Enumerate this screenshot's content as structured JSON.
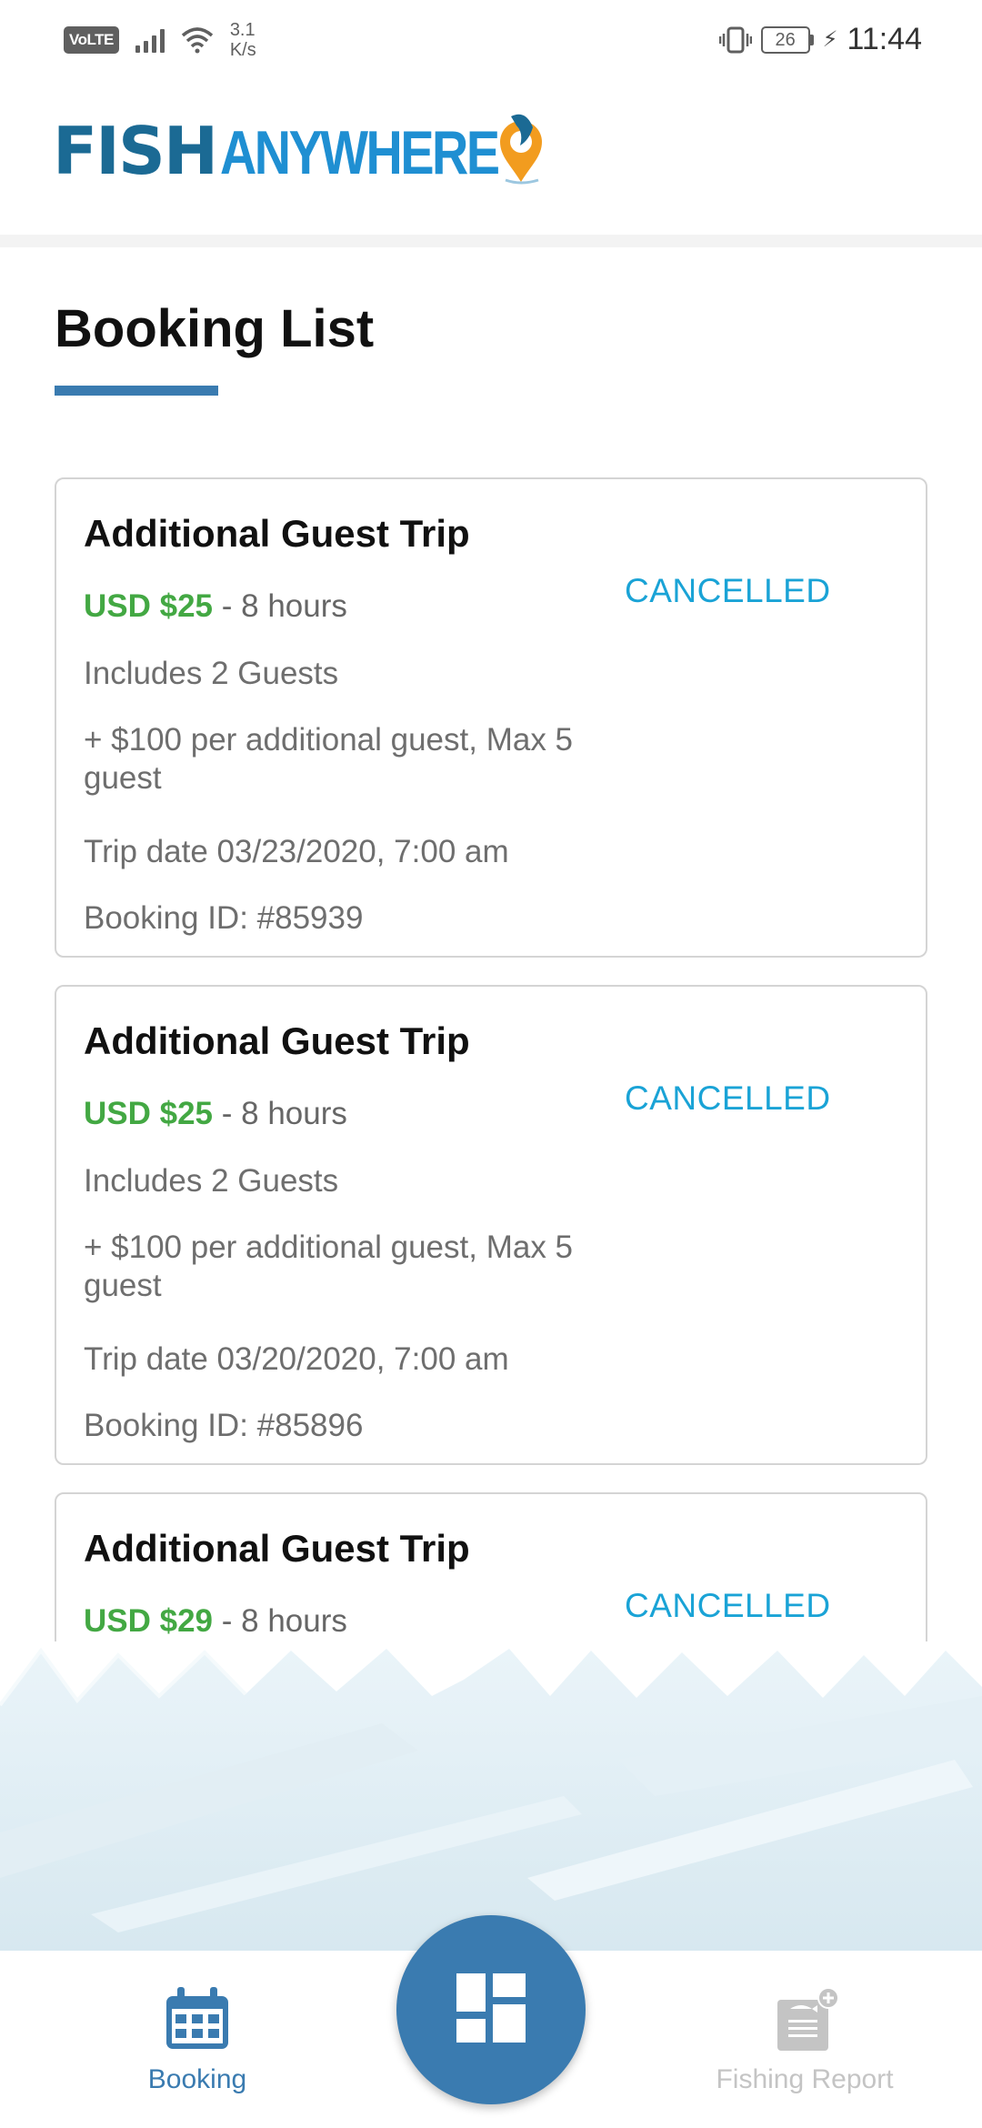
{
  "status_bar": {
    "volte": "VoLTE",
    "net_speed_value": "3.1",
    "net_speed_unit": "K/s",
    "battery": "26",
    "time": "11:44"
  },
  "header": {
    "logo_part1": "FISH",
    "logo_part2": "ANYWHERE"
  },
  "page": {
    "title": "Booking List"
  },
  "bookings": [
    {
      "title": "Additional Guest Trip",
      "price": "USD $25",
      "duration": " - 8 hours",
      "guests": "Includes 2 Guests",
      "extra": "+ $100 per additional guest, Max 5 guest",
      "trip_date": "Trip date 03/23/2020, 7:00 am",
      "booking_id": "Booking ID: #85939",
      "status": "CANCELLED"
    },
    {
      "title": "Additional Guest Trip",
      "price": "USD $25",
      "duration": " - 8 hours",
      "guests": "Includes 2 Guests",
      "extra": "+ $100 per additional guest, Max 5 guest",
      "trip_date": "Trip date 03/20/2020, 7:00 am",
      "booking_id": "Booking ID: #85896",
      "status": "CANCELLED"
    },
    {
      "title": "Additional Guest Trip",
      "price": "USD $29",
      "duration": " - 8 hours",
      "status": "CANCELLED"
    }
  ],
  "bottom_nav": {
    "booking_label": "Booking",
    "fishing_report_label": "Fishing Report"
  },
  "colors": {
    "brand_blue": "#3a7bb0",
    "price_green": "#43a843",
    "status_cyan": "#1aa3d6"
  },
  "icons": {
    "booking": "calendar-icon",
    "fab": "dashboard-icon",
    "fishing_report": "report-add-icon"
  }
}
